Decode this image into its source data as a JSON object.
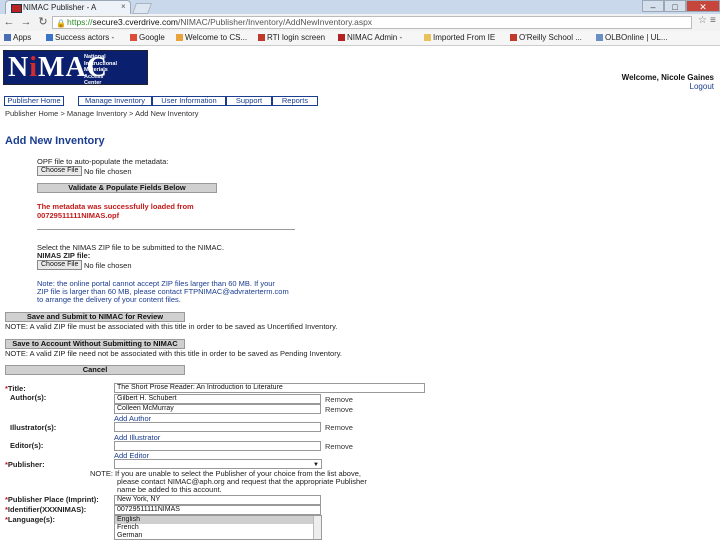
{
  "browser": {
    "tab_title": "NIMAC Publisher - A",
    "tab_close": "×",
    "url_secure": "https://",
    "url_host": "secure3.cverdrive.com",
    "url_path": "/NIMAC/Publisher/Inventory/AddNewInventory.aspx",
    "bookmarks": [
      {
        "label": "Apps",
        "color": "#4a6fb5"
      },
      {
        "label": "Success actors -",
        "color": "#3b73c8"
      },
      {
        "label": "Google",
        "color": "#dd4b39"
      },
      {
        "label": "Welcome to CS...",
        "color": "#e8a33d"
      },
      {
        "label": "RTI login screen",
        "color": "#c0392b"
      },
      {
        "label": "NIMAC Admin -",
        "color": "#b22222"
      },
      {
        "label": "Imported From IE",
        "color": "#e8c15b"
      },
      {
        "label": "O'Reilly School ...",
        "color": "#c0392b"
      },
      {
        "label": "OLBOnline | UL...",
        "color": "#6a8fc4"
      }
    ]
  },
  "site": {
    "logo_text_a": "N",
    "logo_text_b": "i",
    "logo_text_c": "MAC",
    "logo_tagline": "National\nInstructional\nMaterials\nAccess\nCenter",
    "welcome": "Welcome, Nicole Gaines",
    "logout": "Logout"
  },
  "nav": [
    "Publisher Home",
    "Manage Inventory",
    "User Information",
    "Support",
    "Reports"
  ],
  "breadcrumb": "Publisher Home > Manage Inventory > Add New Inventory",
  "page_title": "Add New Inventory",
  "opf": {
    "prompt": "OPF file to auto-populate the metadata:",
    "choose_label": "Choose File",
    "no_file": "No file chosen",
    "validate_label": "Validate & Populate Fields Below",
    "success_line1": "The metadata was successfully loaded from",
    "success_line2": "00729511111NIMAS.opf"
  },
  "nimas": {
    "prompt": "Select the NIMAS ZIP file to be submitted to the NIMAC.",
    "label": "NIMAS ZIP file:",
    "choose_label": "Choose File",
    "no_file": "No file chosen",
    "note_line1": "Note: the online portal cannot accept ZIP files larger than 60 MB. If your",
    "note_line2": "ZIP file is larger than 60 MB, please contact FTPNIMAC@advraterterm.com",
    "note_line3": "to arrange the delivery of your content files."
  },
  "actions": {
    "submit_label": "Save and Submit to NIMAC for Review",
    "submit_note": "NOTE: A valid ZIP file must be associated with this title in order to be saved as Uncertified Inventory.",
    "save_label": "Save to Account Without Submitting to NIMAC",
    "save_note": "NOTE: A valid ZIP file need not be associated with this title in order to be saved as Pending Inventory.",
    "cancel_label": "Cancel"
  },
  "form": {
    "title_label": "Title:",
    "title_value": "The Short Prose Reader: An Introduction to Literature",
    "authors_label": "Author(s):",
    "authors": [
      "Gilbert H. Schubert",
      "Colleen McMurray"
    ],
    "add_author": "Add Author",
    "illustrators_label": "Illustrator(s):",
    "add_illustrator": "Add Illustrator",
    "editors_label": "Editor(s):",
    "add_editor": "Add Editor",
    "remove_label": "Remove",
    "publisher_label": "Publisher:",
    "publisher_note_line1": "NOTE: If you are unable to select the Publisher of your choice from the list above,",
    "publisher_note_line2": "please contact NIMAC@aph.org and request that the appropriate Publisher",
    "publisher_note_line3": "name be added to this account.",
    "place_label": "Publisher Place (Imprint):",
    "place_value": "New York, NY",
    "identifier_label": "Identifier(XXXNIMAS):",
    "identifier_value": "00729511111NIMAS",
    "language_label": "Language(s):",
    "languages": [
      "English",
      "French",
      "German"
    ],
    "selected_language": "English"
  }
}
